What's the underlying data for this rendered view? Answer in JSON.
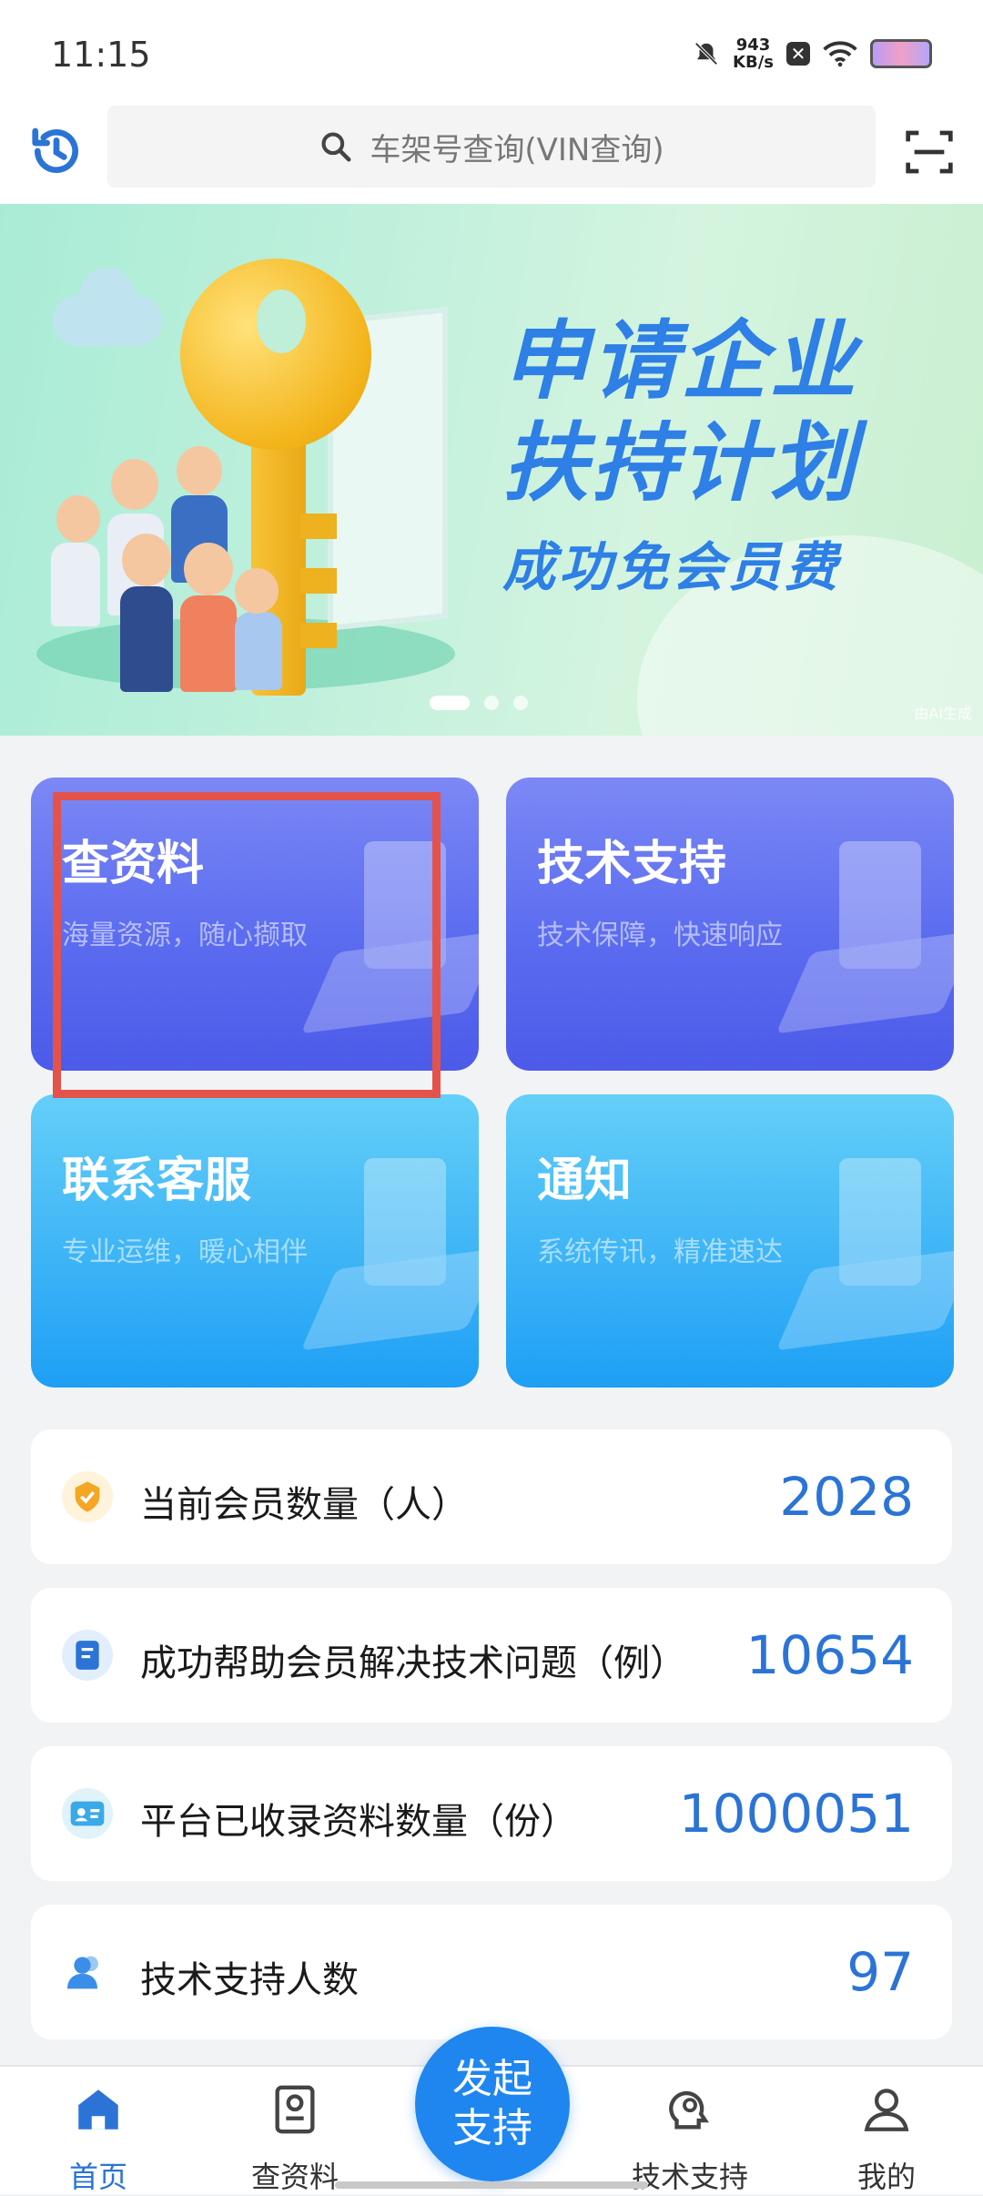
{
  "status_bar": {
    "time": "11:15",
    "net_speed": "943",
    "net_unit": "KB/s"
  },
  "search": {
    "placeholder": "车架号查询(VIN查询)"
  },
  "banner": {
    "title_line1": "申请企业",
    "title_line2": "扶持计划",
    "subtitle": "成功免会员费",
    "ai_tag": "由AI生成",
    "active_dot": 0
  },
  "cards": [
    {
      "title": "查资料",
      "subtitle": "海量资源，随心撷取"
    },
    {
      "title": "技术支持",
      "subtitle": "技术保障，快速响应"
    },
    {
      "title": "联系客服",
      "subtitle": "专业运维，暖心相伴"
    },
    {
      "title": "通知",
      "subtitle": "系统传讯，精准速达"
    }
  ],
  "stats": [
    {
      "label": "当前会员数量（人）",
      "value": "2028",
      "icon": "badge-icon"
    },
    {
      "label": "成功帮助会员解决技术问题（例）",
      "value": "10654",
      "icon": "document-icon"
    },
    {
      "label": "平台已收录资料数量（份）",
      "value": "1000051",
      "icon": "id-card-icon"
    },
    {
      "label": "技术支持人数",
      "value": "97",
      "icon": "people-icon"
    }
  ],
  "bottom_nav": {
    "items": [
      {
        "label": "首页",
        "icon": "home-icon",
        "active": true
      },
      {
        "label": "查资料",
        "icon": "document-search-icon"
      },
      {
        "label": "技术支持",
        "icon": "support-head-icon"
      },
      {
        "label": "我的",
        "icon": "profile-icon"
      }
    ],
    "fab_line1": "发起",
    "fab_line2": "支持"
  },
  "colors": {
    "accent": "#2b74d6",
    "fab": "#1f86f0",
    "highlight": "#e3534c"
  }
}
